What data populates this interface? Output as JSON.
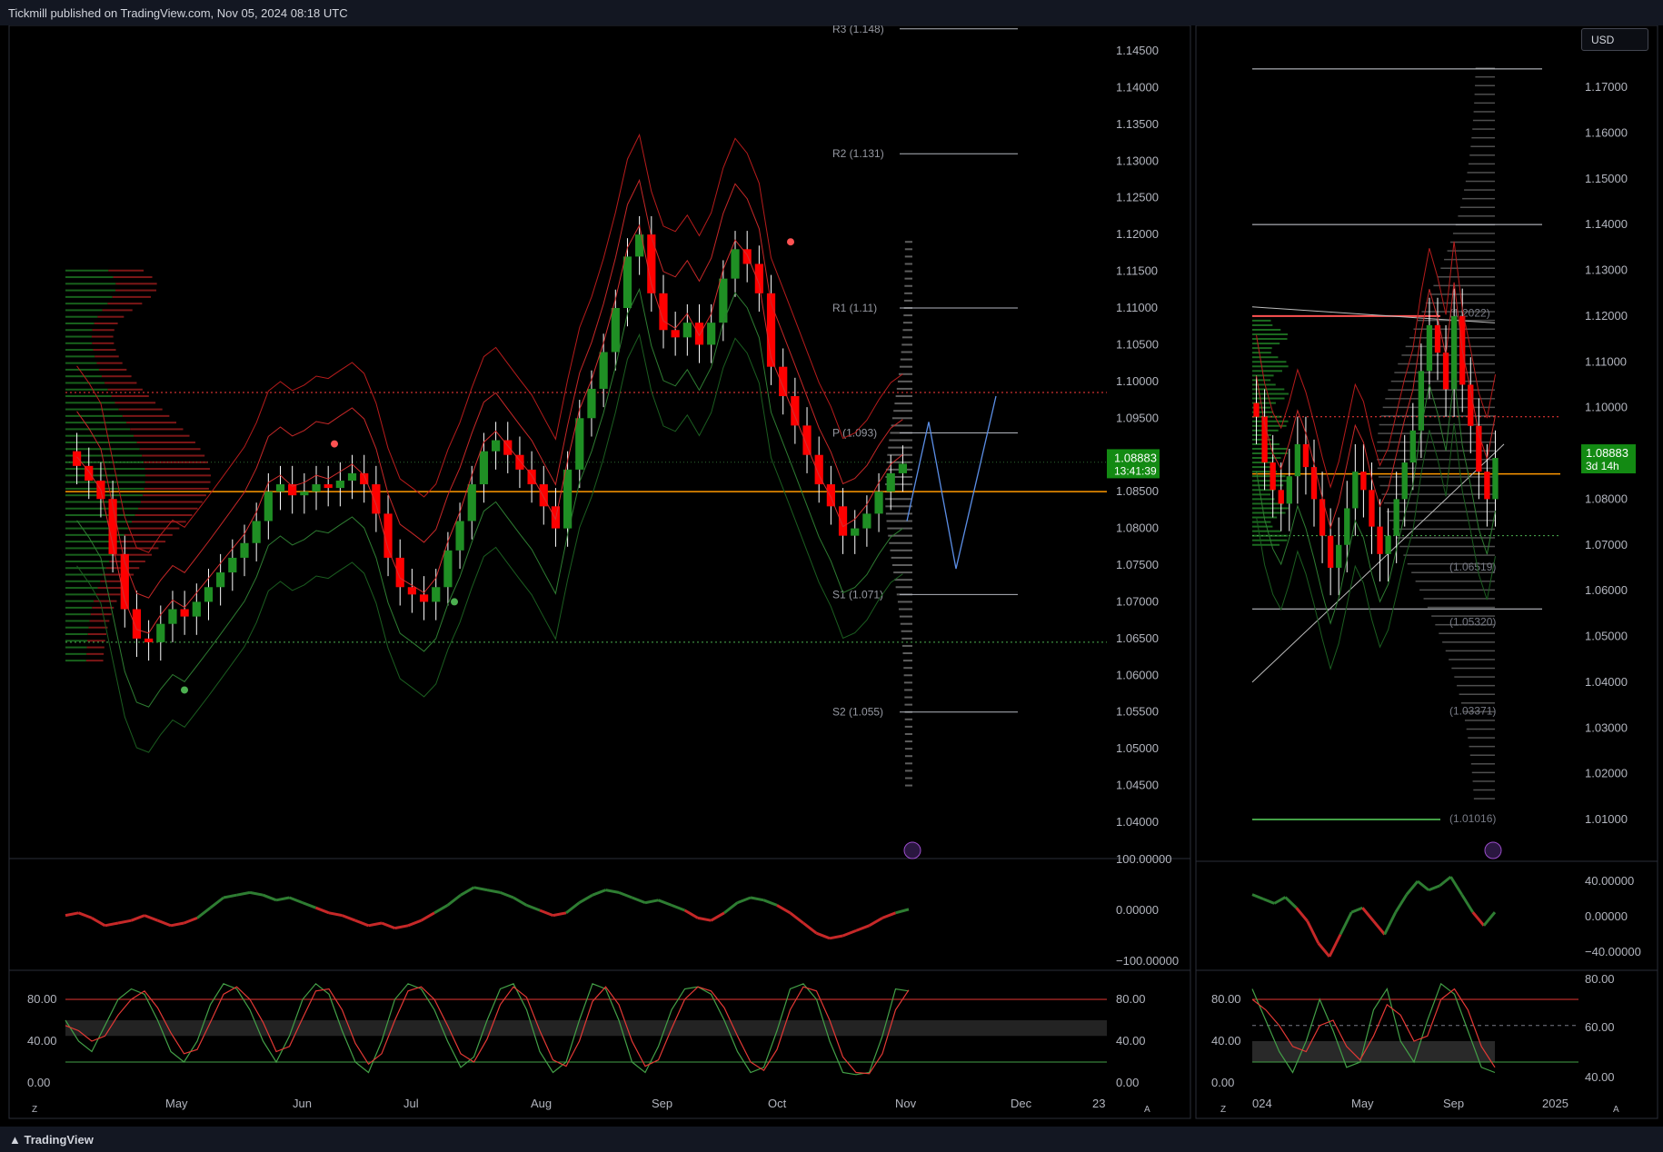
{
  "header": {
    "publisher": "Tickmill published on TradingView.com, Nov 05, 2024 08:18 UTC"
  },
  "footer": {
    "brand": "TradingView"
  },
  "currency_button": "USD",
  "colors": {
    "bull": "#1f8f24",
    "bear": "#ff0000",
    "bg": "#000000",
    "axis_text": "#b2b5be",
    "poc": "#ff9800",
    "price_badge": "#138a13"
  },
  "chart_data": [
    {
      "type": "candlestick",
      "panel": "left-main",
      "y_ticks": [
        "1.14500",
        "1.14000",
        "1.13500",
        "1.13000",
        "1.12500",
        "1.12000",
        "1.11500",
        "1.11000",
        "1.10500",
        "1.10000",
        "1.09500",
        "1.09000",
        "1.08500",
        "1.08000",
        "1.07500",
        "1.07000",
        "1.06500",
        "1.06000",
        "1.05500",
        "1.05000",
        "1.04500",
        "1.04000"
      ],
      "ylim": [
        1.0375,
        1.1485
      ],
      "x_ticks": [
        "May",
        "Jun",
        "Jul",
        "Aug",
        "Sep",
        "Oct",
        "Nov",
        "Dec",
        "23"
      ],
      "pivots": [
        {
          "label": "R3 (1.148)",
          "value": 1.148
        },
        {
          "label": "R2 (1.131)",
          "value": 1.131
        },
        {
          "label": "R1 (1.11)",
          "value": 1.11
        },
        {
          "label": "P (1.093)",
          "value": 1.093
        },
        {
          "label": "S1 (1.071)",
          "value": 1.071
        },
        {
          "label": "S2 (1.055)",
          "value": 1.055
        }
      ],
      "close_series": [
        1.0885,
        1.0865,
        1.084,
        1.0765,
        1.069,
        1.065,
        1.0645,
        1.067,
        1.069,
        1.068,
        1.07,
        1.072,
        1.074,
        1.076,
        1.078,
        1.081,
        1.085,
        1.086,
        1.0845,
        1.085,
        1.086,
        1.0855,
        1.0865,
        1.0875,
        1.086,
        1.082,
        1.076,
        1.072,
        1.071,
        1.07,
        1.072,
        1.077,
        1.081,
        1.086,
        1.0905,
        1.092,
        1.09,
        1.088,
        1.086,
        1.083,
        1.08,
        1.088,
        1.095,
        1.099,
        1.104,
        1.11,
        1.117,
        1.12,
        1.112,
        1.107,
        1.106,
        1.108,
        1.105,
        1.108,
        1.114,
        1.118,
        1.116,
        1.112,
        1.102,
        1.098,
        1.094,
        1.09,
        1.086,
        1.083,
        1.079,
        1.08,
        1.082,
        1.085,
        1.0875,
        1.0888
      ],
      "current_price": {
        "value": "1.08883",
        "countdown": "13:41:39"
      },
      "horizontal_levels": {
        "poc": 1.085,
        "dotted_red": 1.0985,
        "dotted_green": 1.0645,
        "dotted_gray": 1.089
      }
    },
    {
      "type": "line",
      "panel": "left-oscillator",
      "y_ticks": [
        "100.00000",
        "0.00000",
        "−100.00000"
      ],
      "ylim": [
        -100,
        100
      ],
      "values": [
        -10,
        -5,
        -15,
        -30,
        -25,
        -20,
        -10,
        -20,
        -30,
        -25,
        -15,
        5,
        25,
        30,
        35,
        30,
        20,
        25,
        15,
        5,
        -5,
        -10,
        -20,
        -30,
        -25,
        -35,
        -30,
        -20,
        -5,
        10,
        30,
        45,
        40,
        35,
        25,
        10,
        0,
        -10,
        -5,
        15,
        30,
        40,
        35,
        25,
        15,
        20,
        10,
        0,
        -15,
        -20,
        -5,
        15,
        25,
        20,
        10,
        -5,
        -25,
        -45,
        -55,
        -50,
        -40,
        -30,
        -15,
        -5,
        2
      ]
    },
    {
      "type": "line",
      "panel": "left-stochastic",
      "y_ticks_left": [
        "80.00",
        "40.00",
        "0.00"
      ],
      "y_ticks_right": [
        "80.00",
        "40.00",
        "0.00"
      ],
      "ylim": [
        -5,
        100
      ],
      "fast": [
        60,
        40,
        30,
        55,
        80,
        90,
        85,
        60,
        30,
        20,
        40,
        75,
        95,
        90,
        70,
        40,
        20,
        45,
        80,
        95,
        85,
        50,
        20,
        10,
        40,
        80,
        95,
        90,
        70,
        40,
        15,
        25,
        60,
        90,
        95,
        70,
        30,
        10,
        20,
        60,
        95,
        90,
        60,
        20,
        10,
        35,
        70,
        90,
        92,
        85,
        60,
        30,
        10,
        15,
        50,
        90,
        95,
        80,
        40,
        10,
        8,
        10,
        45,
        90,
        88
      ],
      "slow": [
        55,
        50,
        40,
        45,
        65,
        80,
        88,
        72,
        48,
        28,
        32,
        58,
        85,
        92,
        80,
        58,
        30,
        35,
        62,
        88,
        90,
        70,
        38,
        18,
        28,
        60,
        88,
        92,
        80,
        55,
        28,
        20,
        42,
        75,
        92,
        82,
        50,
        22,
        16,
        40,
        78,
        92,
        75,
        40,
        16,
        22,
        52,
        80,
        92,
        88,
        72,
        45,
        20,
        12,
        32,
        70,
        92,
        88,
        60,
        25,
        10,
        9,
        28,
        70,
        89
      ]
    },
    {
      "type": "candlestick",
      "panel": "right-main",
      "y_ticks": [
        "1.17000",
        "1.16000",
        "1.15000",
        "1.14000",
        "1.13000",
        "1.12000",
        "1.11000",
        "1.10000",
        "1.09000",
        "1.08000",
        "1.07000",
        "1.06000",
        "1.05000",
        "1.04000",
        "1.03000",
        "1.02000",
        "1.01000"
      ],
      "ylim": [
        1.006,
        1.1755
      ],
      "x_ticks": [
        "024",
        "May",
        "Sep",
        "2025"
      ],
      "pivot_labels": [
        "(1.2022)",
        "(1.06519)",
        "(1.05320)",
        "(1.03371)",
        "(1.01016)"
      ],
      "current_price": {
        "value": "1.08883",
        "countdown": "3d 14h"
      },
      "close_series": [
        1.098,
        1.088,
        1.082,
        1.079,
        1.085,
        1.092,
        1.087,
        1.08,
        1.072,
        1.065,
        1.07,
        1.078,
        1.086,
        1.082,
        1.074,
        1.068,
        1.072,
        1.08,
        1.088,
        1.095,
        1.108,
        1.118,
        1.112,
        1.104,
        1.12,
        1.105,
        1.096,
        1.086,
        1.08,
        1.089
      ]
    },
    {
      "type": "line",
      "panel": "right-oscillator",
      "y_ticks": [
        "40.00000",
        "0.00000",
        "−40.00000"
      ],
      "ylim": [
        -55,
        55
      ],
      "values": [
        25,
        20,
        15,
        22,
        10,
        -5,
        -30,
        -45,
        -20,
        5,
        10,
        -5,
        -20,
        5,
        25,
        40,
        30,
        35,
        45,
        25,
        5,
        -10,
        5
      ]
    },
    {
      "type": "line",
      "panel": "right-stochastic",
      "y_ticks_left": [
        "80.00",
        "40.00",
        "0.00"
      ],
      "y_ticks_right": [
        "80.00",
        "60.00",
        "40.00"
      ],
      "ylim": [
        -5,
        100
      ],
      "fast": [
        90,
        60,
        30,
        10,
        40,
        80,
        50,
        15,
        20,
        70,
        90,
        40,
        20,
        60,
        95,
        85,
        50,
        15,
        10
      ],
      "slow": [
        80,
        70,
        55,
        35,
        30,
        55,
        60,
        35,
        22,
        45,
        75,
        65,
        40,
        45,
        80,
        90,
        70,
        35,
        15
      ]
    }
  ]
}
